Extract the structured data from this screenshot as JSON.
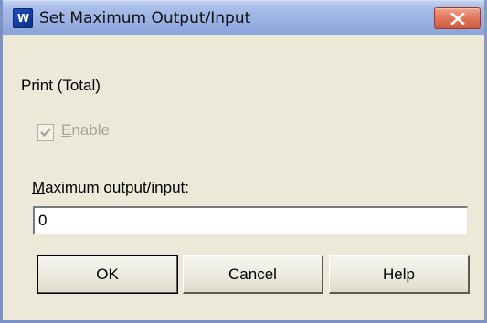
{
  "window": {
    "title": "Set Maximum Output/Input",
    "app_icon_glyph": "🞳"
  },
  "group": {
    "label": "Print (Total)"
  },
  "enable_checkbox": {
    "label_underlined": "E",
    "label_rest": "nable",
    "checked": true,
    "enabled": false
  },
  "max_field": {
    "label_underlined": "M",
    "label_rest": "aximum output/input:",
    "value": "0"
  },
  "buttons": {
    "ok": "OK",
    "cancel": "Cancel",
    "help": "Help"
  },
  "colors": {
    "dialog_bg": "#ece9d8",
    "titlebar": "#9db3e3",
    "close_button": "#e0785e"
  }
}
